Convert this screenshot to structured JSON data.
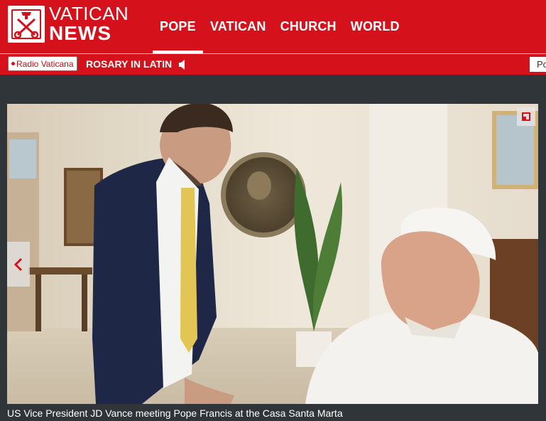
{
  "brand": {
    "line1": "VATICAN",
    "line2": "NEWS"
  },
  "nav": [
    {
      "label": "POPE",
      "active": true
    },
    {
      "label": "VATICAN"
    },
    {
      "label": "CHURCH"
    },
    {
      "label": "WORLD"
    }
  ],
  "subbar": {
    "radio_label": "Radio Vaticana",
    "rosary_label": "ROSARY IN LATIN",
    "right_partial": "Po"
  },
  "article": {
    "caption": "US Vice President JD Vance meeting Pope Francis at the Casa Santa Marta"
  },
  "colors": {
    "brand_red": "#d5121c",
    "page_bg": "#2f3539"
  },
  "icons": [
    "vatican-keys-icon",
    "speaker-icon",
    "expand-icon",
    "chevron-left-icon"
  ]
}
